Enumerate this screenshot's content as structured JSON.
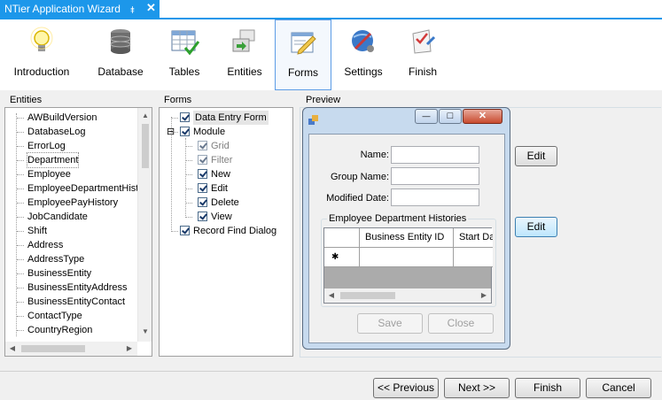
{
  "window": {
    "tab_title": "NTier Application Wizard",
    "pin_glyph": "⯒",
    "close_glyph": "✕"
  },
  "toolbar": {
    "items": [
      {
        "label": "Introduction",
        "icon": "lightbulb-icon"
      },
      {
        "label": "Database",
        "icon": "database-icon"
      },
      {
        "label": "Tables",
        "icon": "table-icon"
      },
      {
        "label": "Entities",
        "icon": "entities-icon"
      },
      {
        "label": "Forms",
        "icon": "form-icon",
        "active": true
      },
      {
        "label": "Settings",
        "icon": "settings-icon"
      },
      {
        "label": "Finish",
        "icon": "finish-icon"
      }
    ]
  },
  "entities": {
    "label": "Entities",
    "items": [
      "AWBuildVersion",
      "DatabaseLog",
      "ErrorLog",
      "Department",
      "Employee",
      "EmployeeDepartmentHist",
      "EmployeePayHistory",
      "JobCandidate",
      "Shift",
      "Address",
      "AddressType",
      "BusinessEntity",
      "BusinessEntityAddress",
      "BusinessEntityContact",
      "ContactType",
      "CountryRegion"
    ],
    "selected": "Department"
  },
  "forms": {
    "label": "Forms",
    "items": [
      {
        "label": "Data Entry Form",
        "checked": true,
        "level": 0,
        "selected": true
      },
      {
        "label": "Module",
        "checked": true,
        "level": 0,
        "expander": "⊟"
      },
      {
        "label": "Grid",
        "checked": true,
        "level": 1,
        "dim": true
      },
      {
        "label": "Filter",
        "checked": true,
        "level": 1,
        "dim": true
      },
      {
        "label": "New",
        "checked": true,
        "level": 1
      },
      {
        "label": "Edit",
        "checked": true,
        "level": 1
      },
      {
        "label": "Delete",
        "checked": true,
        "level": 1
      },
      {
        "label": "View",
        "checked": true,
        "level": 1
      },
      {
        "label": "Record Find Dialog",
        "checked": true,
        "level": 0
      }
    ]
  },
  "preview": {
    "label": "Preview",
    "window_buttons": {
      "minimize": "—",
      "maximize": "□",
      "close": "✕"
    },
    "fields": [
      {
        "label": "Name:",
        "value": ""
      },
      {
        "label": "Group Name:",
        "value": ""
      },
      {
        "label": "Modified Date:",
        "value": ""
      }
    ],
    "grid": {
      "title": "Employee Department Histories",
      "columns": [
        "Business Entity ID",
        "Start Date"
      ],
      "new_row_glyph": "✱"
    },
    "save_label": "Save",
    "close_label": "Close",
    "edit_label_1": "Edit",
    "edit_label_2": "Edit"
  },
  "footer": {
    "previous_label": "<< Previous",
    "next_label": "Next >>",
    "finish_label": "Finish",
    "cancel_label": "Cancel"
  },
  "scroll": {
    "up": "▲",
    "down": "▼",
    "left": "◀",
    "right": "▶"
  }
}
